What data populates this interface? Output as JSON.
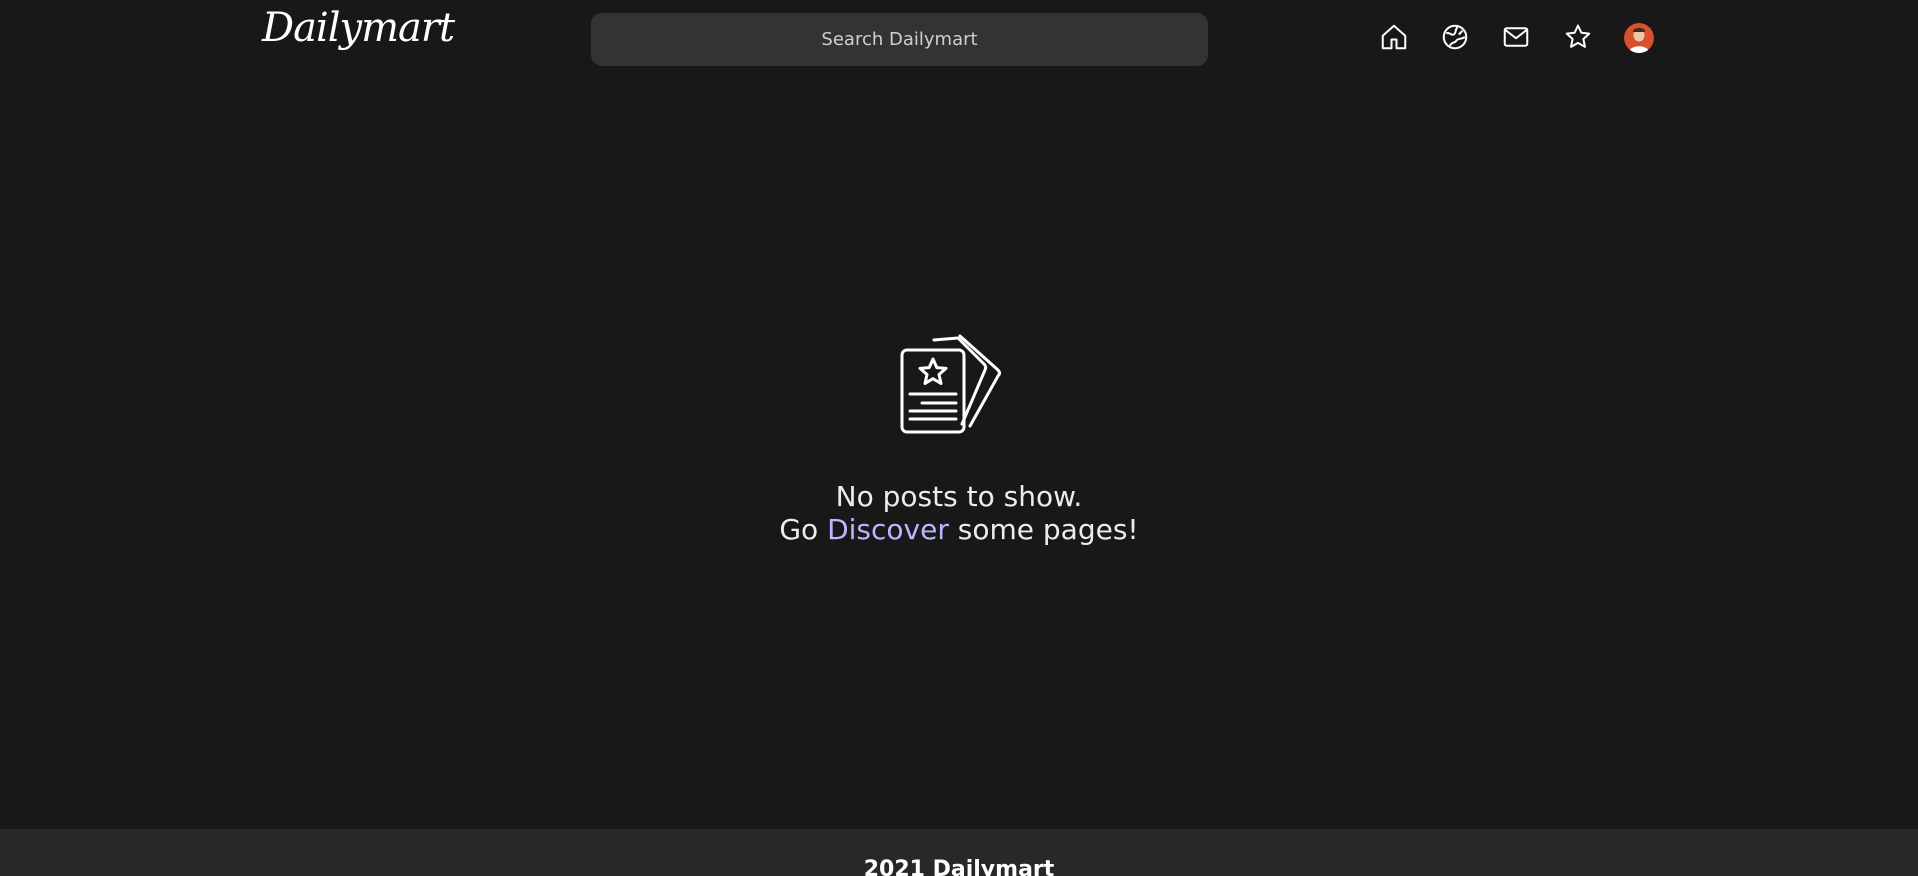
{
  "header": {
    "logo": "Dailymart",
    "search_placeholder": "Search Dailymart",
    "nav_icons": [
      "home-icon",
      "discover-icon",
      "mail-icon",
      "star-icon",
      "avatar"
    ]
  },
  "main": {
    "empty_line1": "No posts to show.",
    "empty_line2_prefix": "Go ",
    "discover_link": "Discover",
    "empty_line2_suffix": " some pages!",
    "illustration_icon": "posts-cards-icon"
  },
  "footer": {
    "text": "2021 Dailymart"
  },
  "colors": {
    "background": "#181818",
    "search_bg": "#333333",
    "footer_bg": "#282828",
    "link": "#b9b6ff",
    "avatar": "#d9502f"
  }
}
